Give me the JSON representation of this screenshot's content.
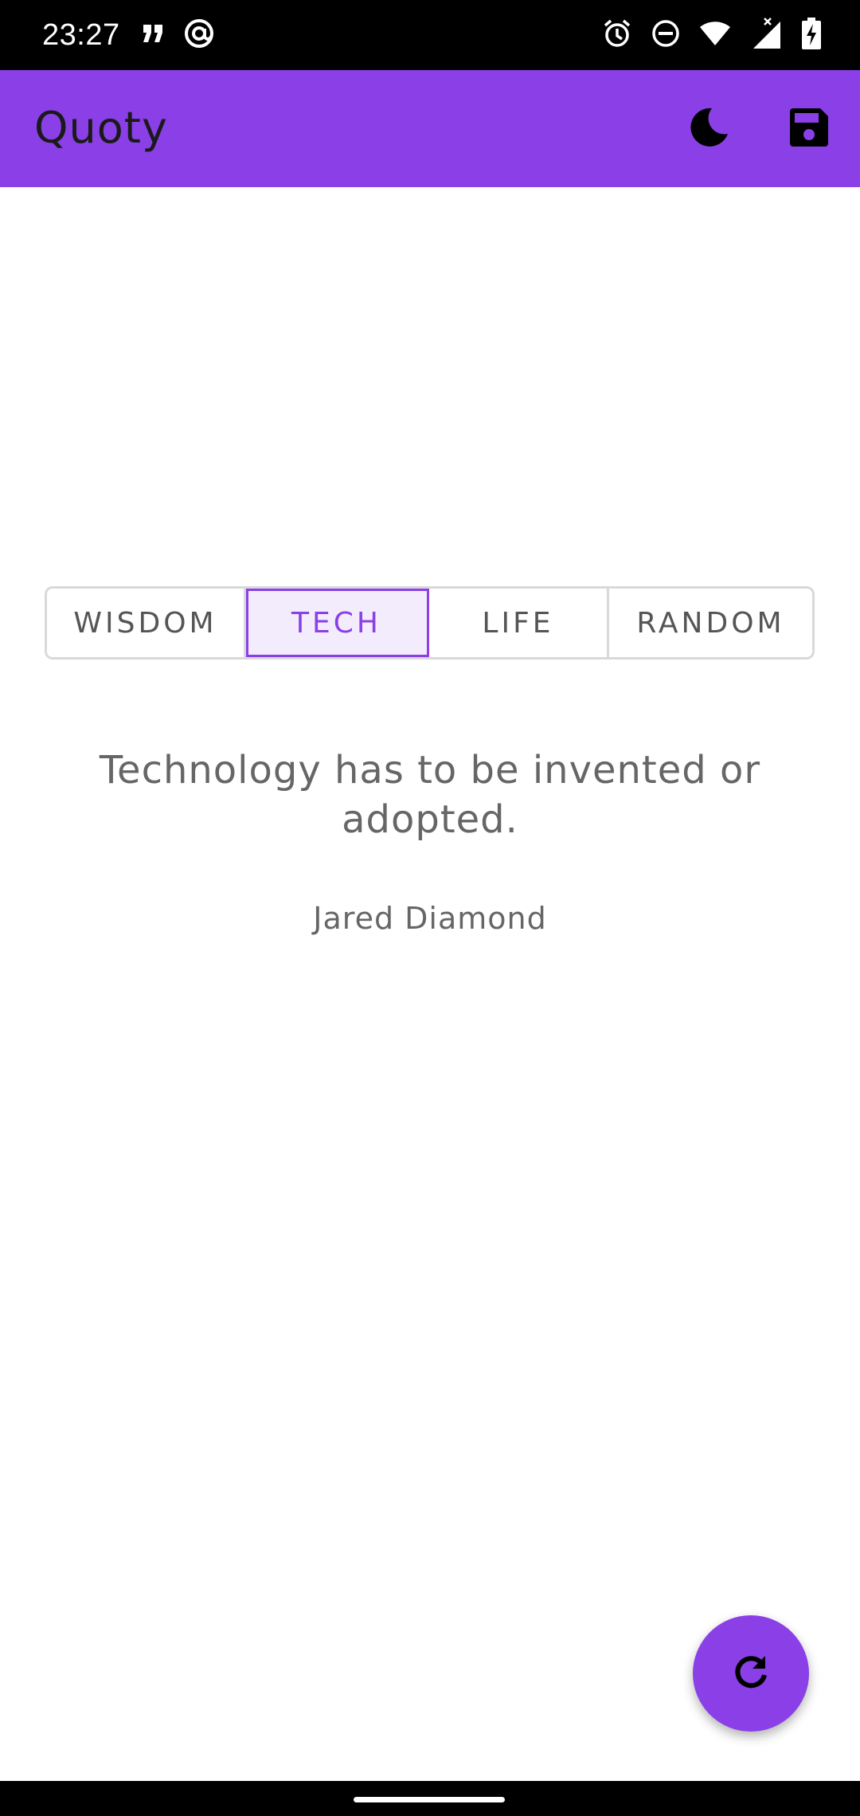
{
  "status_bar": {
    "time": "23:27",
    "left_icons": [
      "quote-notification-icon",
      "at-sign-notification-icon"
    ],
    "right_icons": [
      "alarm-icon",
      "do-not-disturb-icon",
      "wifi-icon",
      "cell-signal-icon",
      "battery-charging-icon"
    ]
  },
  "app_bar": {
    "title": "Quoty",
    "actions": [
      "dark-mode-toggle",
      "save"
    ]
  },
  "categories": {
    "items": [
      "WISDOM",
      "TECH",
      "LIFE",
      "RANDOM"
    ],
    "selected": "TECH"
  },
  "quote": {
    "text": "Technology has to be invented or adopted.",
    "author": "Jared Diamond"
  },
  "fab": {
    "icon": "refresh-icon"
  },
  "colors": {
    "accent": "#8a40e6",
    "selected_tab_bg": "#f3ecfc",
    "text_secondary": "#666666"
  }
}
